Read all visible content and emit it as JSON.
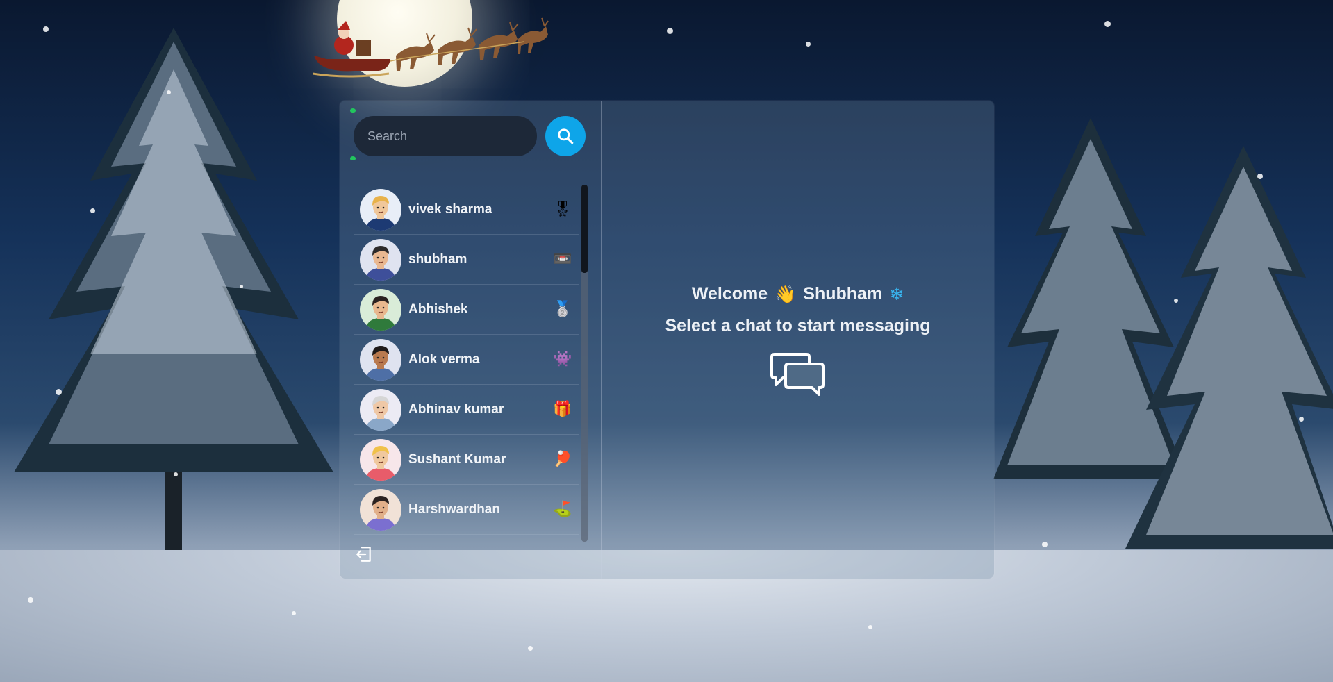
{
  "search": {
    "placeholder": "Search"
  },
  "contacts": [
    {
      "name": "vivek sharma",
      "emoji": "🎖",
      "avatar_colors": {
        "skin": "#f0c79a",
        "hair": "#e8b24a",
        "shirt": "#1d3a73",
        "bg": "#e8eef7"
      }
    },
    {
      "name": "shubham",
      "emoji": "📼",
      "avatar_colors": {
        "skin": "#e9b891",
        "hair": "#2d2a2a",
        "shirt": "#3e4f9a",
        "bg": "#dfe3f0"
      }
    },
    {
      "name": "Abhishek",
      "emoji": "🥈",
      "avatar_colors": {
        "skin": "#e8b88e",
        "hair": "#2b2220",
        "shirt": "#2f7a3b",
        "bg": "#d9ecd8"
      }
    },
    {
      "name": "Alok verma",
      "emoji": "👾",
      "avatar_colors": {
        "skin": "#b97a4f",
        "hair": "#1f1a19",
        "shirt": "#4e6fa6",
        "bg": "#dfe3f0"
      }
    },
    {
      "name": "Abhinav kumar",
      "emoji": "🎁",
      "avatar_colors": {
        "skin": "#efc8a6",
        "hair": "#d6d6d6",
        "shirt": "#8aa7c8",
        "bg": "#ecebf4"
      }
    },
    {
      "name": "Sushant Kumar",
      "emoji": "🏓",
      "avatar_colors": {
        "skin": "#f0c89e",
        "hair": "#f0c14a",
        "shirt": "#e85c6a",
        "bg": "#f7e6ea"
      }
    },
    {
      "name": "Harshwardhan",
      "emoji": "⛳",
      "avatar_colors": {
        "skin": "#e2b08a",
        "hair": "#2b2220",
        "shirt": "#7b6fd0",
        "bg": "#f1e2d7"
      }
    }
  ],
  "main": {
    "welcome": "Welcome",
    "wave_emoji": "👋",
    "username": "Shubham",
    "snow_emoji": "❄",
    "prompt": "Select a chat to start messaging"
  },
  "icons": {
    "search_button": "search-icon",
    "logout": "logout-icon",
    "chat": "chat-bubbles-icon"
  },
  "colors": {
    "accent": "#0ea5e9",
    "online_dot": "#22c55e",
    "search_bg": "#1d2838"
  }
}
